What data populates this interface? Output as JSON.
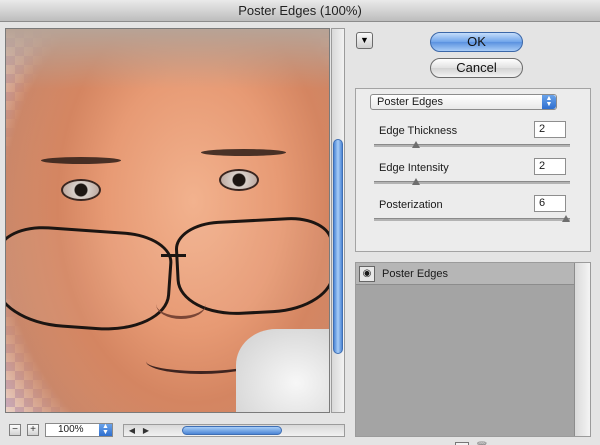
{
  "window": {
    "title": "Poster Edges (100%)"
  },
  "buttons": {
    "ok": "OK",
    "cancel": "Cancel"
  },
  "icons": {
    "collapse": "triangle-down-icon",
    "zoom_out": "minus-icon",
    "zoom_in": "plus-icon",
    "eye": "eye-icon",
    "new_layer": "new-layer-icon",
    "delete_layer": "trash-icon"
  },
  "zoom": {
    "value": "100%",
    "minus": "−",
    "plus": "+"
  },
  "filter": {
    "selected": "Poster Edges",
    "params": [
      {
        "label": "Edge Thickness",
        "value": "2",
        "level": 0.2
      },
      {
        "label": "Edge Intensity",
        "value": "2",
        "level": 0.2
      },
      {
        "label": "Posterization",
        "value": "6",
        "level": 1.0
      }
    ]
  },
  "layers": [
    {
      "label": "Poster Edges"
    }
  ],
  "accent": "#5a92e0"
}
